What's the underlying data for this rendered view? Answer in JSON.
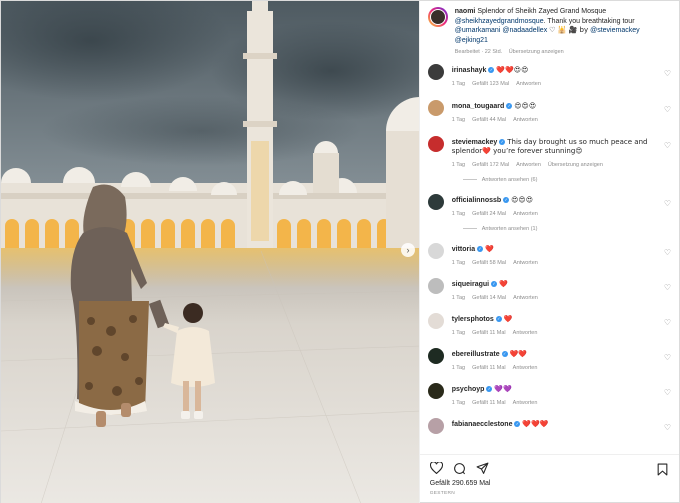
{
  "post": {
    "author": "naomi",
    "caption_text": "Splendor of Sheikh Zayed Grand Mosque",
    "caption_mention_1": "@sheikhzayedgrandmosque",
    "caption_mid": ". Thank you breathtaking tour",
    "caption_mention_2": "@umarkamani",
    "caption_mention_3": "@nadaadellex",
    "caption_emoji": "♡ 🕌 🎥 by",
    "caption_mention_4": "@steviemackey",
    "caption_mention_5": "@ejking21",
    "edited": "Bearbeitet · 22 Std.",
    "translate": "Übersetzung anzeigen"
  },
  "comments": [
    {
      "user": "irinashayk",
      "verified": true,
      "text": "❤️❤️😍😍",
      "time": "1 Tag",
      "likes": "Gefällt 123 Mal",
      "reply": "Antworten",
      "avatar_color": "#3b3b3b"
    },
    {
      "user": "mona_tougaard",
      "verified": true,
      "text": "😍😍😍",
      "time": "1 Tag",
      "likes": "Gefällt 44 Mal",
      "reply": "Antworten",
      "avatar_color": "#c99a6b"
    },
    {
      "user": "steviemackey",
      "verified": true,
      "text": "This day brought us so much peace and splendor❤️ you’re forever stunning😍",
      "time": "1 Tag",
      "likes": "Gefällt 172 Mal",
      "reply": "Antworten",
      "translate": "Übersetzung anzeigen",
      "view_replies": "Antworten ansehen (6)",
      "avatar_color": "#c62d2d"
    },
    {
      "user": "officialinnossb",
      "verified": true,
      "text": "😍😍😍",
      "time": "1 Tag",
      "likes": "Gefällt 24 Mal",
      "reply": "Antworten",
      "view_replies": "Antworten ansehen (1)",
      "avatar_color": "#2d3a3a"
    },
    {
      "user": "vittoria",
      "verified": true,
      "text": "❤️",
      "time": "1 Tag",
      "likes": "Gefällt 58 Mal",
      "reply": "Antworten",
      "avatar_color": "#d8d8d8"
    },
    {
      "user": "siqueiragui",
      "verified": true,
      "text": "❤️",
      "time": "1 Tag",
      "likes": "Gefällt 14 Mal",
      "reply": "Antworten",
      "avatar_color": "#bdbdbd"
    },
    {
      "user": "tylersphotos",
      "verified": true,
      "text": "❤️",
      "time": "1 Tag",
      "likes": "Gefällt 11 Mal",
      "reply": "Antworten",
      "avatar_color": "#e3dcd6"
    },
    {
      "user": "ebereillustrate",
      "verified": true,
      "text": "❤️❤️",
      "time": "1 Tag",
      "likes": "Gefällt 11 Mal",
      "reply": "Antworten",
      "avatar_color": "#1e2b22"
    },
    {
      "user": "psychoyp",
      "verified": true,
      "text": "💜💜",
      "time": "1 Tag",
      "likes": "Gefällt 11 Mal",
      "reply": "Antworten",
      "avatar_color": "#2a2a1a"
    },
    {
      "user": "fabianaecclestone",
      "verified": true,
      "text": "❤️❤️❤️",
      "time": "",
      "likes": "",
      "reply": "",
      "avatar_color": "#b7a0a6"
    }
  ],
  "footer": {
    "likes": "Gefällt 290.659 Mal",
    "date": "GESTERN"
  },
  "icons": [
    "heart-icon",
    "comment-icon",
    "share-icon",
    "bookmark-icon",
    "carousel-next-icon"
  ],
  "colors": {
    "mention": "#00376b",
    "verified": "#3897f0",
    "meta": "#8e8e8e",
    "heart_red": "#ed1a3b"
  }
}
